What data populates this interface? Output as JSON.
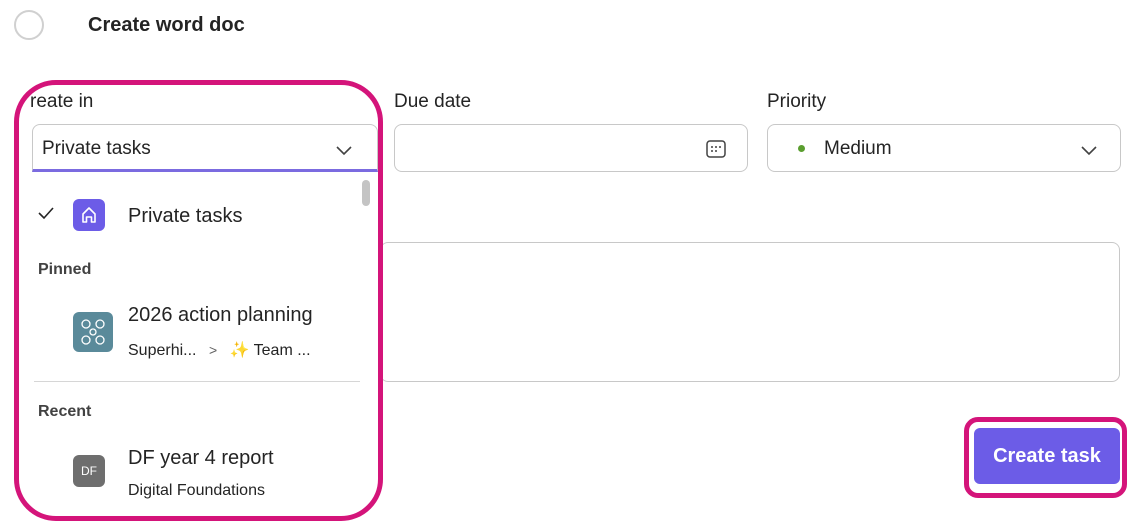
{
  "task": {
    "title": "Create word doc"
  },
  "form": {
    "create_in": {
      "label": "reate in",
      "value": "Private tasks"
    },
    "due_date": {
      "label": "Due date",
      "value": ""
    },
    "priority": {
      "label": "Priority",
      "value": "Medium",
      "dot_color": "#5a9e2f"
    }
  },
  "dropdown": {
    "selected": {
      "label": "Private tasks",
      "icon": "home-icon",
      "icon_color": "#6c5ce7"
    },
    "sections": [
      {
        "heading": "Pinned",
        "items": [
          {
            "title": "2026 action planning",
            "sub_a": "Superhi...",
            "sub_sep": ">",
            "sub_b": "✨ Team ...",
            "icon": "sparkle-pattern-icon"
          }
        ]
      },
      {
        "heading": "Recent",
        "items": [
          {
            "title": "DF year 4 report",
            "sub_a": "Digital Foundations",
            "initials": "DF",
            "icon": "initials-avatar"
          }
        ]
      }
    ]
  },
  "actions": {
    "create_label": "Create task"
  },
  "colors": {
    "accent": "#6c5ce7",
    "highlight": "#d4147a"
  }
}
